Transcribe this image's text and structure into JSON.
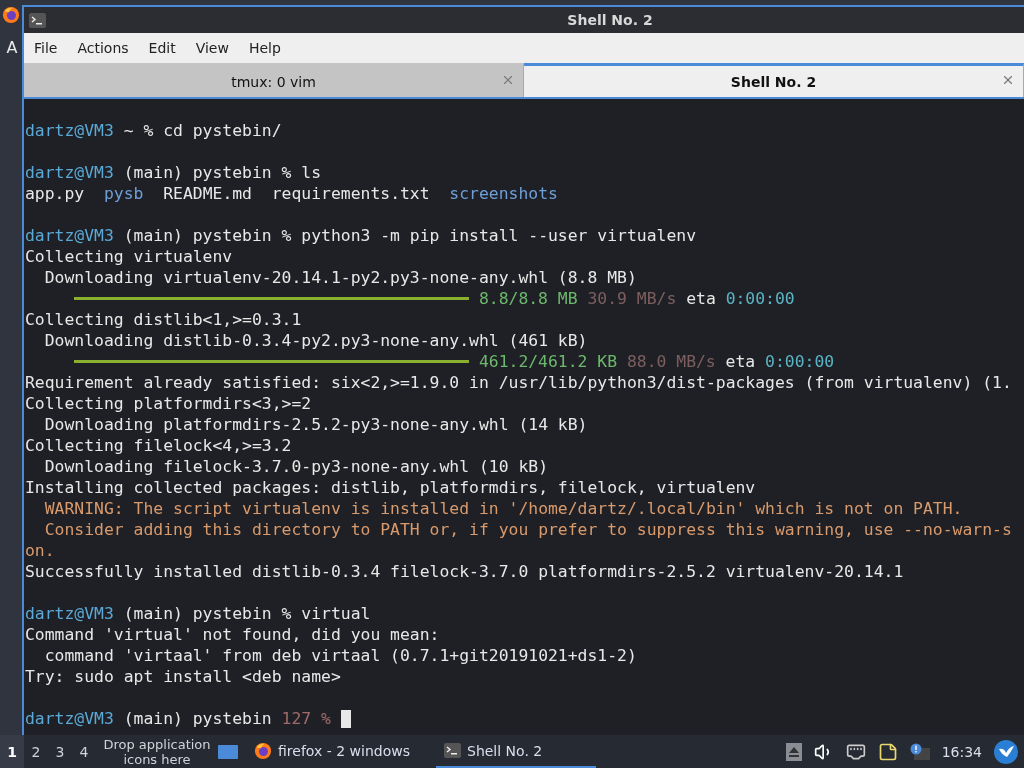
{
  "desktop": {
    "edge_letter": "A"
  },
  "window": {
    "title": "Shell No. 2"
  },
  "menu": [
    "File",
    "Actions",
    "Edit",
    "View",
    "Help"
  ],
  "tabs": [
    {
      "label": "tmux: 0 vim",
      "selected": false
    },
    {
      "label": "Shell No. 2",
      "selected": true
    }
  ],
  "terminal": {
    "cursor": true,
    "lines": [
      {
        "kind": "text",
        "segments": [
          {
            "text": "dartz@VM3",
            "kind": "user"
          },
          {
            "text": " ~ % cd pystebin/",
            "kind": "plain"
          }
        ]
      },
      {
        "kind": "blank"
      },
      {
        "kind": "text",
        "segments": [
          {
            "text": "dartz@VM3",
            "kind": "user"
          },
          {
            "text": " (main) pystebin % ls",
            "kind": "plain"
          }
        ]
      },
      {
        "kind": "text",
        "segments": [
          {
            "text": "app.py  ",
            "kind": "plain"
          },
          {
            "text": "pysb",
            "kind": "dir"
          },
          {
            "text": "  README.md  requirements.txt  ",
            "kind": "plain"
          },
          {
            "text": "screenshots",
            "kind": "dir"
          }
        ]
      },
      {
        "kind": "blank"
      },
      {
        "kind": "text",
        "segments": [
          {
            "text": "dartz@VM3",
            "kind": "user"
          },
          {
            "text": " (main) pystebin % python3 -m pip install --user virtualenv",
            "kind": "plain"
          }
        ]
      },
      {
        "kind": "text",
        "segments": [
          {
            "text": "Collecting virtualenv",
            "kind": "plain"
          }
        ]
      },
      {
        "kind": "text",
        "segments": [
          {
            "text": "  Downloading virtualenv-20.14.1-py2.py3-none-any.whl (8.8 MB)",
            "kind": "plain"
          }
        ]
      },
      {
        "kind": "progress",
        "level": 1,
        "segments": [
          {
            "text": "8.8/8.8 MB",
            "kind": "ok"
          },
          {
            "text": " 30.9 MB/s",
            "kind": "rate"
          },
          {
            "text": " eta ",
            "kind": "plain"
          },
          {
            "text": "0:00:00",
            "kind": "time"
          }
        ]
      },
      {
        "kind": "text",
        "segments": [
          {
            "text": "Collecting distlib<1,>=0.3.1",
            "kind": "plain"
          }
        ]
      },
      {
        "kind": "text",
        "segments": [
          {
            "text": "  Downloading distlib-0.3.4-py2.py3-none-any.whl (461 kB)",
            "kind": "plain"
          }
        ]
      },
      {
        "kind": "progress",
        "level": 1,
        "segments": [
          {
            "text": "461.2/461.2 KB",
            "kind": "ok"
          },
          {
            "text": " 88.0 MB/s",
            "kind": "rate"
          },
          {
            "text": " eta ",
            "kind": "plain"
          },
          {
            "text": "0:00:00",
            "kind": "time"
          }
        ]
      },
      {
        "kind": "text",
        "segments": [
          {
            "text": "Requirement already satisfied: six<2,>=1.9.0 in /usr/lib/python3/dist-packages (from virtualenv) (1.",
            "kind": "plain"
          }
        ]
      },
      {
        "kind": "text",
        "segments": [
          {
            "text": "Collecting platformdirs<3,>=2",
            "kind": "plain"
          }
        ]
      },
      {
        "kind": "text",
        "segments": [
          {
            "text": "  Downloading platformdirs-2.5.2-py3-none-any.whl (14 kB)",
            "kind": "plain"
          }
        ]
      },
      {
        "kind": "text",
        "segments": [
          {
            "text": "Collecting filelock<4,>=3.2",
            "kind": "plain"
          }
        ]
      },
      {
        "kind": "text",
        "segments": [
          {
            "text": "  Downloading filelock-3.7.0-py3-none-any.whl (10 kB)",
            "kind": "plain"
          }
        ]
      },
      {
        "kind": "text",
        "segments": [
          {
            "text": "Installing collected packages: distlib, platformdirs, filelock, virtualenv",
            "kind": "plain"
          }
        ]
      },
      {
        "kind": "text",
        "segments": [
          {
            "text": "  WARNING: The script virtualenv is installed in '/home/dartz/.local/bin' which is not on PATH.",
            "kind": "warn"
          }
        ]
      },
      {
        "kind": "text",
        "segments": [
          {
            "text": "  Consider adding this directory to PATH or, if you prefer to suppress this warning, use --no-warn-s",
            "kind": "warn"
          }
        ]
      },
      {
        "kind": "text",
        "segments": [
          {
            "text": "on.",
            "kind": "warn"
          }
        ]
      },
      {
        "kind": "text",
        "segments": [
          {
            "text": "Successfully installed distlib-0.3.4 filelock-3.7.0 platformdirs-2.5.2 virtualenv-20.14.1",
            "kind": "plain"
          }
        ]
      },
      {
        "kind": "blank"
      },
      {
        "kind": "text",
        "segments": [
          {
            "text": "dartz@VM3",
            "kind": "user"
          },
          {
            "text": " (main) pystebin % virtual",
            "kind": "plain"
          }
        ]
      },
      {
        "kind": "text",
        "segments": [
          {
            "text": "Command 'virtual' not found, did you mean:",
            "kind": "plain"
          }
        ]
      },
      {
        "kind": "text",
        "segments": [
          {
            "text": "  command 'virtaal' from deb virtaal (0.7.1+git20191021+ds1-2)",
            "kind": "plain"
          }
        ]
      },
      {
        "kind": "text",
        "segments": [
          {
            "text": "Try: sudo apt install <deb name>",
            "kind": "plain"
          }
        ]
      },
      {
        "kind": "blank"
      },
      {
        "kind": "text",
        "segments": [
          {
            "text": "dartz@VM3",
            "kind": "user"
          },
          {
            "text": " (main) pystebin ",
            "kind": "plain"
          },
          {
            "text": "127 %",
            "kind": "status"
          }
        ]
      }
    ]
  },
  "taskbar": {
    "workspaces": [
      {
        "label": "1",
        "selected": true
      },
      {
        "label": "2",
        "selected": false
      },
      {
        "label": "3",
        "selected": false
      },
      {
        "label": "4",
        "selected": false
      }
    ],
    "launcher_hint": "Drop application icons here",
    "tasks": [
      {
        "label": "firefox - 2 windows",
        "kind": "browser",
        "selected": false
      },
      {
        "label": "Shell No. 2",
        "kind": "terminal",
        "selected": true
      }
    ],
    "clock": "16:34"
  }
}
